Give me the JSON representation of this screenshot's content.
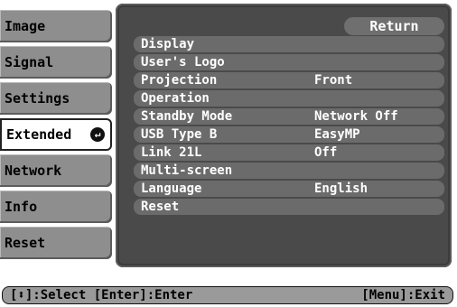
{
  "sidebar": {
    "items": [
      {
        "label": "Image"
      },
      {
        "label": "Signal"
      },
      {
        "label": "Settings"
      },
      {
        "label": "Extended",
        "active": true,
        "icon": "enter-icon"
      },
      {
        "label": "Network"
      },
      {
        "label": "Info"
      },
      {
        "label": "Reset"
      }
    ]
  },
  "panel": {
    "return_label": "Return",
    "rows": [
      {
        "label": "Display",
        "value": ""
      },
      {
        "label": "User's Logo",
        "value": ""
      },
      {
        "label": "Projection",
        "value": "Front"
      },
      {
        "label": "Operation",
        "value": ""
      },
      {
        "label": "Standby Mode",
        "value": "Network Off"
      },
      {
        "label": "USB Type B",
        "value": "EasyMP"
      },
      {
        "label": "Link 21L",
        "value": "Off"
      },
      {
        "label": "Multi-screen",
        "value": ""
      },
      {
        "label": "Language",
        "value": "English"
      },
      {
        "label": "Reset",
        "value": ""
      }
    ]
  },
  "footer": {
    "left": "[⬍]:Select [Enter]:Enter",
    "right": "[Menu]:Exit"
  },
  "colors": {
    "panel_bg": "#4a4a4a",
    "row_bg": "#6b6b6b",
    "tab_bg": "#8e8e8e",
    "tab_active_bg": "#ffffff"
  }
}
